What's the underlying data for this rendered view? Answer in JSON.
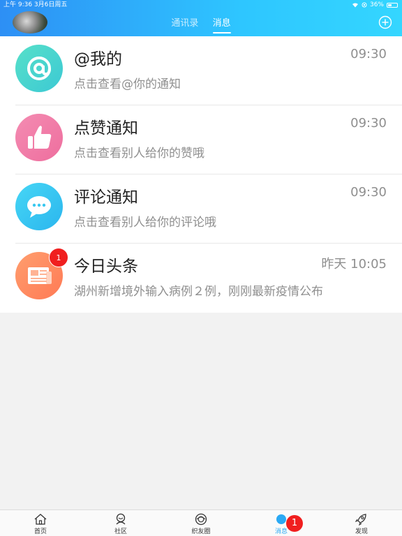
{
  "status_bar": {
    "time_date": "上午 9:36   3月6日周五",
    "battery": "36%"
  },
  "header": {
    "tabs": [
      {
        "label": "通讯录",
        "active": false
      },
      {
        "label": "消息",
        "active": true
      }
    ]
  },
  "messages": [
    {
      "icon": "at-icon",
      "color": "#4fd6c7",
      "title": "@我的",
      "subtitle": "点击查看@你的通知",
      "time": "09:30"
    },
    {
      "icon": "thumbs-up-icon",
      "color": "#f27aa6",
      "title": "点赞通知",
      "subtitle": "点击查看别人给你的赞哦",
      "time": "09:30"
    },
    {
      "icon": "chat-bubble-icon",
      "color": "#38c8f0",
      "title": "评论通知",
      "subtitle": "点击查看别人给你的评论哦",
      "time": "09:30"
    },
    {
      "icon": "newspaper-icon",
      "color": "#ff8a5c",
      "title": "今日头条",
      "subtitle": "湖州新增境外输入病例２例，刚刚最新疫情公布",
      "time": "昨天 10:05",
      "badge": "1"
    }
  ],
  "tabbar": {
    "items": [
      {
        "label": "首页",
        "icon": "home-icon"
      },
      {
        "label": "社区",
        "icon": "community-icon"
      },
      {
        "label": "织友圈",
        "icon": "moments-icon"
      },
      {
        "label": "消息",
        "icon": "message-icon",
        "active": true,
        "badge": "1"
      },
      {
        "label": "发现",
        "icon": "rocket-icon"
      }
    ]
  }
}
